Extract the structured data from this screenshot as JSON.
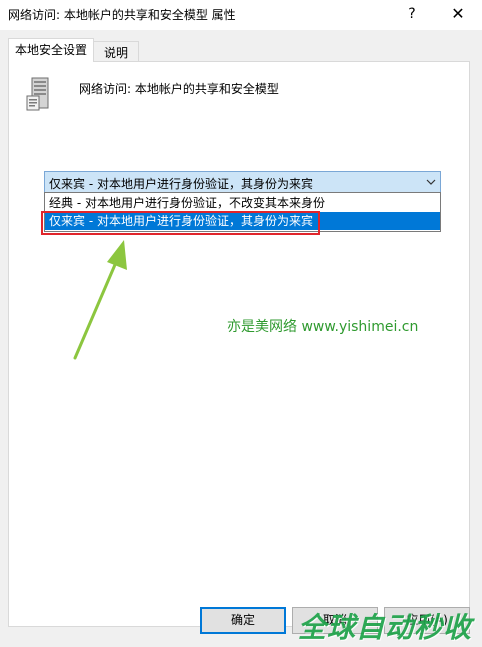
{
  "window": {
    "title": "网络访问: 本地帐户的共享和安全模型 属性",
    "help_label": "?",
    "close_label": "✕"
  },
  "tabs": [
    {
      "label": "本地安全设置",
      "active": true
    },
    {
      "label": "说明",
      "active": false
    }
  ],
  "policy": {
    "icon": "server-policy-icon",
    "name": "网络访问: 本地帐户的共享和安全模型"
  },
  "combo": {
    "selected": "仅来宾 - 对本地用户进行身份验证，其身份为来宾",
    "arrow_icon": "chevron-down-icon",
    "options": [
      "经典 - 对本地用户进行身份验证，不改变其本来身份",
      "仅来宾 - 对本地用户进行身份验证，其身份为来宾"
    ],
    "highlighted_index": 1
  },
  "annotation": {
    "highlight_color": "#e0252b",
    "arrow_color": "#8cc63f",
    "watermark": "亦是美网络 www.yishimei.cn"
  },
  "buttons": {
    "ok": "确定",
    "cancel": "取消",
    "apply": "应用(A)"
  },
  "brand": {
    "text": "全球自动秒收"
  },
  "colors": {
    "accent": "#0078d7",
    "selection_bg": "#cce4f7"
  }
}
